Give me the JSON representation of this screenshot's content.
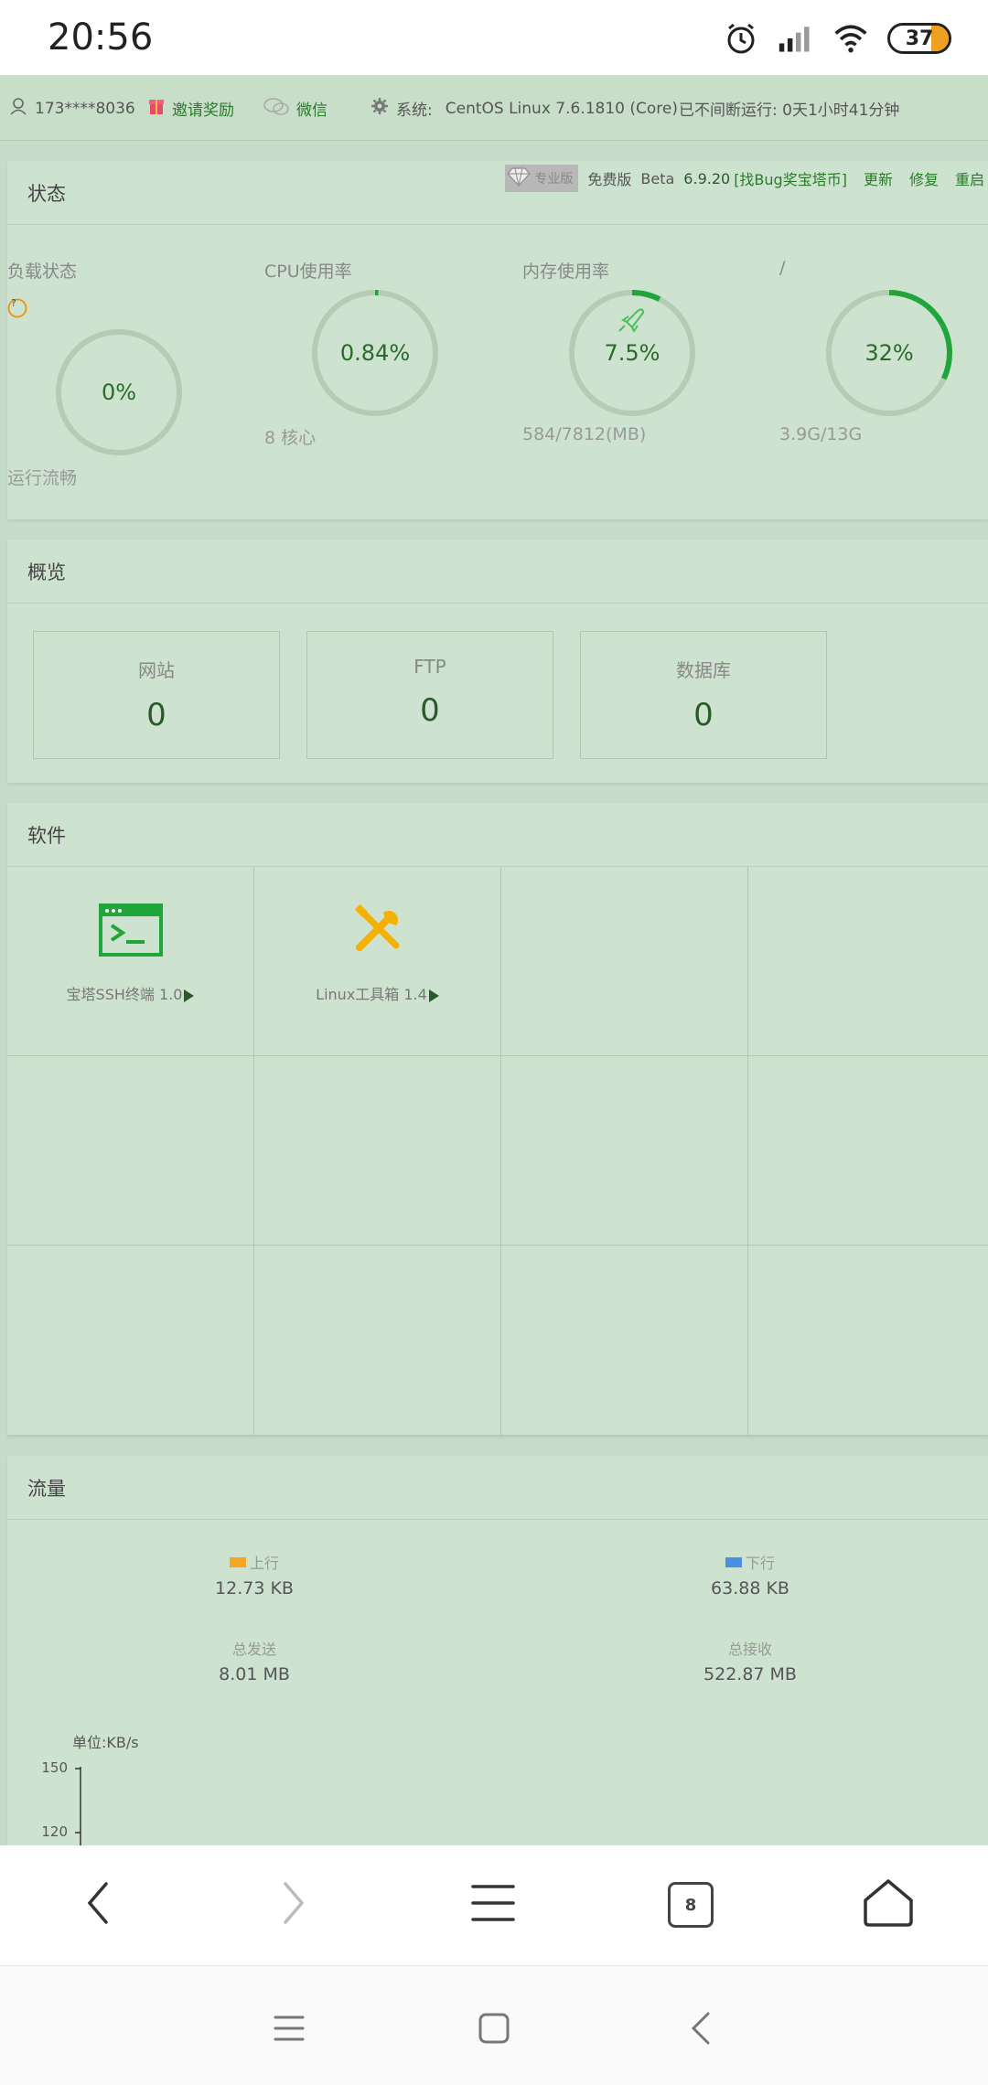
{
  "status_bar": {
    "time": "20:56",
    "battery": "37",
    "icons": [
      "alarm-icon",
      "signal-icon",
      "wifi-icon",
      "battery-icon"
    ]
  },
  "top_bar": {
    "user": "173****8036",
    "invite": "邀请奖励",
    "wechat": "微信",
    "system_label": "系统:",
    "system_value": "CentOS Linux 7.6.1810 (Core)",
    "uptime": "已不间断运行: 0天1小时41分钟"
  },
  "status_panel": {
    "title": "状态",
    "version": {
      "pro_label": "专业版",
      "free_label": "免费版",
      "beta_label": "Beta",
      "version_num": "6.9.20",
      "bug_link": "[找Bug奖宝塔币]",
      "update": "更新",
      "repair": "修复",
      "restart": "重启"
    },
    "gauges": [
      {
        "title": "负载状态",
        "value": "0%",
        "sub": "运行流畅",
        "percent": 0,
        "help": "?"
      },
      {
        "title": "CPU使用率",
        "value": "0.84%",
        "sub": "8 核心",
        "percent": 0.84
      },
      {
        "title": "内存使用率",
        "value": "7.5%",
        "sub": "584/7812(MB)",
        "percent": 7.5
      },
      {
        "title": "/",
        "value": "32%",
        "sub": "3.9G/13G",
        "percent": 32
      }
    ]
  },
  "overview_panel": {
    "title": "概览",
    "boxes": [
      {
        "label": "网站",
        "value": "0"
      },
      {
        "label": "FTP",
        "value": "0"
      },
      {
        "label": "数据库",
        "value": "0"
      }
    ]
  },
  "software_panel": {
    "title": "软件",
    "items": [
      {
        "name": "宝塔SSH终端 1.0",
        "icon": "terminal-icon"
      },
      {
        "name": "Linux工具箱 1.4",
        "icon": "tools-icon"
      }
    ]
  },
  "traffic_panel": {
    "title": "流量",
    "up_label": "上行",
    "up_value": "12.73 KB",
    "down_label": "下行",
    "down_value": "63.88 KB",
    "total_sent_label": "总发送",
    "total_sent_value": "8.01 MB",
    "total_recv_label": "总接收",
    "total_recv_value": "522.87 MB",
    "unit": "单位:KB/s",
    "ticks": [
      "150",
      "120"
    ],
    "up_color": "#f5a623",
    "down_color": "#4a90e2"
  },
  "browser_bar": {
    "tab_count": "8",
    "buttons": [
      "back-icon",
      "forward-icon",
      "menu-icon",
      "tabs-icon",
      "home-icon"
    ]
  },
  "colors": {
    "accent_green": "#20a53a",
    "ring_gray": "#b5cbb3",
    "panel_bg": "#cde3cf"
  }
}
